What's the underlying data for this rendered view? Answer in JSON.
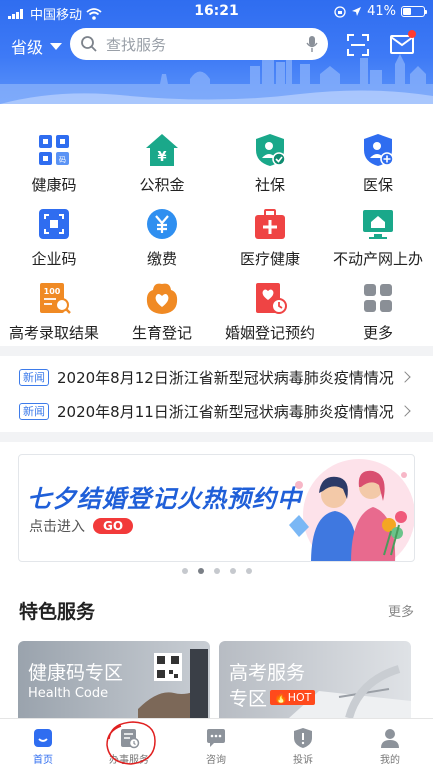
{
  "status_bar": {
    "carrier": "中国移动",
    "time": "16:21",
    "battery_percent": "41%",
    "battery_level": 0.41
  },
  "header": {
    "province_label": "省级",
    "search_placeholder": "查找服务"
  },
  "services": [
    {
      "label": "健康码",
      "icon": "health-code-icon",
      "color": "#2f6df0"
    },
    {
      "label": "公积金",
      "icon": "housing-fund-icon",
      "color": "#1aa88a"
    },
    {
      "label": "社保",
      "icon": "social-security-icon",
      "color": "#1aa88a"
    },
    {
      "label": "医保",
      "icon": "medical-insurance-icon",
      "color": "#2f6df0"
    },
    {
      "label": "企业码",
      "icon": "enterprise-code-icon",
      "color": "#2f6df0"
    },
    {
      "label": "缴费",
      "icon": "payment-icon",
      "color": "#2f8ff0"
    },
    {
      "label": "医疗健康",
      "icon": "medical-kit-icon",
      "color": "#ef4444"
    },
    {
      "label": "不动产网上办",
      "icon": "real-estate-icon",
      "color": "#1aa88a"
    },
    {
      "label": "高考录取结果",
      "icon": "exam-result-icon",
      "color": "#f08a24"
    },
    {
      "label": "生育登记",
      "icon": "birth-registration-icon",
      "color": "#f08a24"
    },
    {
      "label": "婚姻登记预约",
      "icon": "marriage-booking-icon",
      "color": "#ef4444"
    },
    {
      "label": "更多",
      "icon": "more-grid-icon",
      "color": "#8a8f96"
    }
  ],
  "news": [
    {
      "tag": "新闻",
      "text": "2020年8月12日浙江省新型冠状病毒肺炎疫情情况"
    },
    {
      "tag": "新闻",
      "text": "2020年8月11日浙江省新型冠状病毒肺炎疫情情况"
    }
  ],
  "banner": {
    "title": "七夕结婚登记火热预约中",
    "subtitle": "点击进入",
    "button": "GO",
    "active_index": 1,
    "count": 5
  },
  "featured": {
    "title": "特色服务",
    "more": "更多",
    "cards": [
      {
        "title": "健康码专区",
        "subtitle": "Health Code"
      },
      {
        "title_line1": "高考服务",
        "title_line2": "专区",
        "badge": "HOT"
      }
    ]
  },
  "tabs": [
    {
      "label": "首页",
      "icon": "home-icon",
      "active": true
    },
    {
      "label": "办事服务",
      "icon": "service-document-icon",
      "active": false
    },
    {
      "label": "咨询",
      "icon": "chat-icon",
      "active": false
    },
    {
      "label": "投诉",
      "icon": "complaint-shield-icon",
      "active": false
    },
    {
      "label": "我的",
      "icon": "profile-icon",
      "active": false
    }
  ],
  "colors": {
    "brand_blue": "#2f6df0",
    "annotation_red": "#e02020"
  }
}
